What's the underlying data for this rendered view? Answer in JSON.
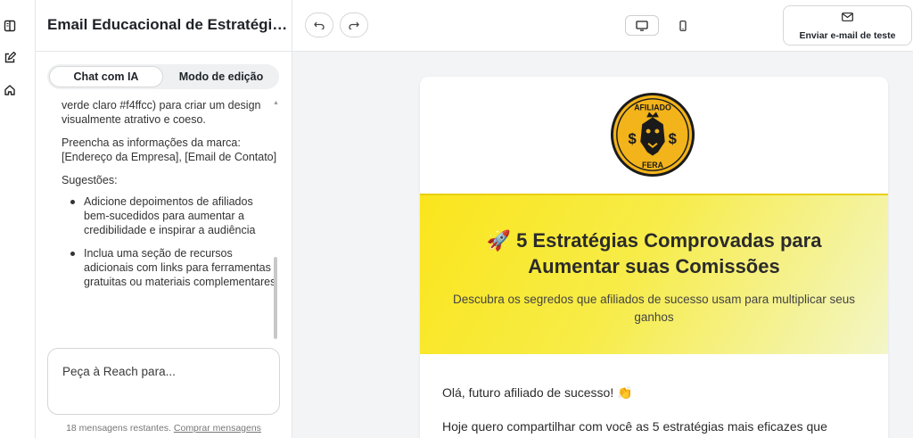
{
  "sidebar": {
    "title": "Email Educacional de Estratégias de Afiliados",
    "tabs": {
      "chat": "Chat com IA",
      "edit": "Modo de edição"
    },
    "messages": {
      "fragment": "verde claro #f4ffcc) para criar um design visualmente atrativo e coeso.",
      "brand_info": "Preencha as informações da marca: [Endereço da Empresa], [Email de Contato]",
      "suggestions_heading": "Sugestões:",
      "suggestions": [
        "Adicione depoimentos de afiliados bem-sucedidos para aumentar a credibilidade e inspirar a audiência",
        "Inclua uma seção de recursos adicionais com links para ferramentas gratuitas ou materiais complementares"
      ]
    },
    "prompt_placeholder": "Peça à Reach para...",
    "remaining_text": "18 mensagens restantes.",
    "buy_link": "Comprar mensagens"
  },
  "toolbar": {
    "send_test_label": "Enviar e-mail de teste"
  },
  "email": {
    "logo_text_top": "AFILIADO",
    "logo_text_bottom": "FERA",
    "colors": {
      "hero_yellow": "#fae51c",
      "hero_light": "#f3f6c8",
      "logo_gold": "#f2b31b"
    },
    "hero_title": "🚀 5 Estratégias Comprovadas para Aumentar suas Comissões",
    "hero_subtitle": "Descubra os segredos que afiliados de sucesso usam para multiplicar seus ganhos",
    "greeting": "Olá, futuro afiliado de sucesso! 👏",
    "intro": "Hoje quero compartilhar com você as 5 estratégias mais eficazes que"
  },
  "icons": {
    "rail": [
      "book-icon",
      "edit-icon",
      "home-icon"
    ],
    "toolbar": [
      "undo-icon",
      "redo-icon",
      "desktop-icon",
      "mobile-icon",
      "mail-icon"
    ]
  }
}
